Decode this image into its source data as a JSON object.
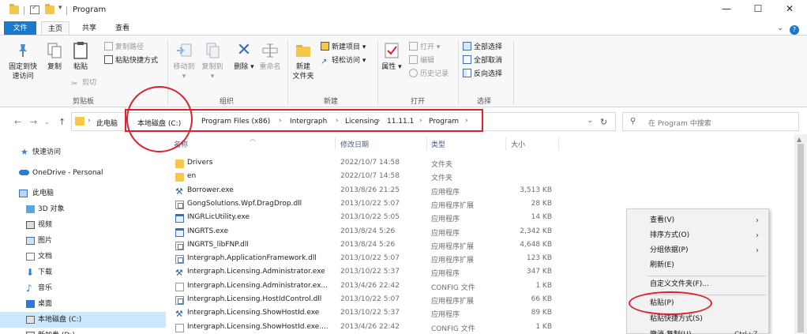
{
  "window": {
    "title": "Program",
    "minimize": "—",
    "maximize": "☐",
    "close": "✕"
  },
  "ribbon_tabs": {
    "file": "文件",
    "home": "主页",
    "share": "共享",
    "view": "查看"
  },
  "ribbon": {
    "clipboard": {
      "label": "剪贴板",
      "pin_line1": "固定到快",
      "pin_line2": "速访问",
      "copy": "复制",
      "paste": "粘贴",
      "copy_path": "复制路径",
      "paste_shortcut": "粘贴快捷方式",
      "cut": "剪切"
    },
    "organize": {
      "label": "组织",
      "move_to": "移动到",
      "copy_to": "复制到",
      "delete": "删除",
      "rename": "重命名"
    },
    "new": {
      "label": "新建",
      "new_folder_line1": "新建",
      "new_folder_line2": "文件夹",
      "new_item": "新建项目",
      "easy_access": "轻松访问"
    },
    "open": {
      "label": "打开",
      "properties": "属性",
      "open": "打开",
      "edit": "编辑",
      "history": "历史记录"
    },
    "select": {
      "label": "选择",
      "select_all": "全部选择",
      "select_none": "全部取消",
      "invert": "反向选择"
    }
  },
  "address_bar": {
    "crumbs": [
      "此电脑",
      "本地磁盘 (C:)",
      "Program Files (x86)",
      "Intergraph",
      "Licensing",
      "11.11.1",
      "Program"
    ],
    "search_placeholder": "在 Program 中搜索"
  },
  "nav_pane": {
    "items": [
      {
        "label": "快速访问",
        "icon": "star-icon"
      },
      {
        "label": "OneDrive - Personal",
        "icon": "cloud-icon"
      },
      {
        "label": "此电脑",
        "icon": "computer-icon"
      },
      {
        "label": "3D 对象",
        "icon": "cube-icon"
      },
      {
        "label": "视频",
        "icon": "video-icon"
      },
      {
        "label": "图片",
        "icon": "picture-icon"
      },
      {
        "label": "文档",
        "icon": "document-icon"
      },
      {
        "label": "下载",
        "icon": "download-icon"
      },
      {
        "label": "音乐",
        "icon": "music-icon"
      },
      {
        "label": "桌面",
        "icon": "desktop-icon"
      },
      {
        "label": "本地磁盘 (C:)",
        "icon": "drive-icon"
      },
      {
        "label": "新加卷 (D:)",
        "icon": "drive-icon"
      }
    ]
  },
  "file_list": {
    "columns": {
      "name": "名称",
      "modified": "修改日期",
      "type": "类型",
      "size": "大小"
    },
    "rows": [
      {
        "name": "Drivers",
        "modified": "2022/10/7 14:58",
        "type": "文件夹",
        "size": "",
        "icon": "folder"
      },
      {
        "name": "en",
        "modified": "2022/10/7 14:58",
        "type": "文件夹",
        "size": "",
        "icon": "folder"
      },
      {
        "name": "Borrower.exe",
        "modified": "2013/8/26 21:25",
        "type": "应用程序",
        "size": "3,513 KB",
        "icon": "tool"
      },
      {
        "name": "GongSolutions.Wpf.DragDrop.dll",
        "modified": "2013/10/22 5:07",
        "type": "应用程序扩展",
        "size": "28 KB",
        "icon": "dll"
      },
      {
        "name": "INGRLicUtility.exe",
        "modified": "2013/10/22 5:05",
        "type": "应用程序",
        "size": "14 KB",
        "icon": "exe"
      },
      {
        "name": "INGRTS.exe",
        "modified": "2013/8/24 5:26",
        "type": "应用程序",
        "size": "2,342 KB",
        "icon": "exe"
      },
      {
        "name": "INGRTS_libFNP.dll",
        "modified": "2013/8/24 5:26",
        "type": "应用程序扩展",
        "size": "4,648 KB",
        "icon": "dll"
      },
      {
        "name": "Intergraph.ApplicationFramework.dll",
        "modified": "2013/10/22 5:07",
        "type": "应用程序扩展",
        "size": "123 KB",
        "icon": "dll"
      },
      {
        "name": "Intergraph.Licensing.Administrator.exe",
        "modified": "2013/10/22 5:37",
        "type": "应用程序",
        "size": "347 KB",
        "icon": "tool"
      },
      {
        "name": "Intergraph.Licensing.Administrator.ex...",
        "modified": "2013/4/26 22:42",
        "type": "CONFIG 文件",
        "size": "1 KB",
        "icon": "config"
      },
      {
        "name": "Intergraph.Licensing.HostIdControl.dll",
        "modified": "2013/10/22 5:07",
        "type": "应用程序扩展",
        "size": "66 KB",
        "icon": "dll"
      },
      {
        "name": "Intergraph.Licensing.ShowHostId.exe",
        "modified": "2013/10/22 5:37",
        "type": "应用程序",
        "size": "89 KB",
        "icon": "tool"
      },
      {
        "name": "Intergraph.Licensing.ShowHostId.exe....",
        "modified": "2013/4/26 22:42",
        "type": "CONFIG 文件",
        "size": "1 KB",
        "icon": "config"
      }
    ]
  },
  "context_menu": {
    "view": "查看(V)",
    "sort_by": "排序方式(O)",
    "group_by": "分组依据(P)",
    "refresh": "刷新(E)",
    "customize": "自定义文件夹(F)...",
    "paste": "粘贴(P)",
    "paste_shortcut": "粘贴快捷方式(S)",
    "undo": "撤消 复制(U)",
    "undo_shortcut": "Ctrl+Z"
  },
  "colors": {
    "accent": "#1979ca",
    "annotation_red": "#d9232e",
    "selection": "#cce8ff"
  }
}
